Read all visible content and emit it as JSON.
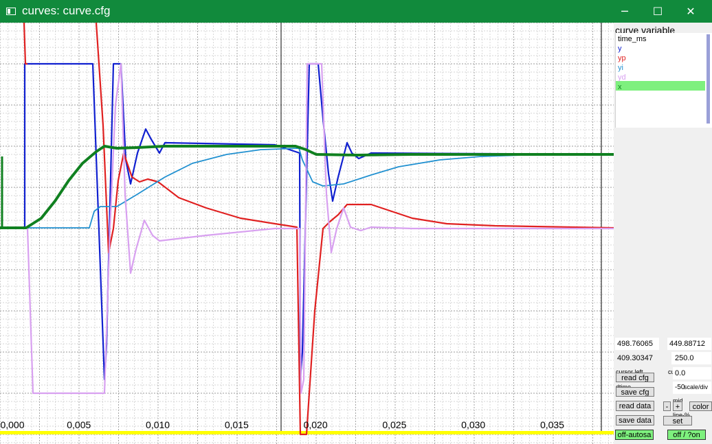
{
  "window": {
    "title": "curves: curve.cfg",
    "minimize_glyph": "─",
    "maximize_glyph": "☐",
    "close_glyph": "✕",
    "titlebar_color": "#118a3c"
  },
  "plot": {
    "x_tick_labels": [
      "0,000",
      "0,005",
      "0,010",
      "0,015",
      "0,020",
      "0,025",
      "0,030",
      "0,035"
    ],
    "x_range": [
      0.0,
      0.0389
    ],
    "series": [
      {
        "name": "time_ms",
        "color": "#000000"
      },
      {
        "name": "y",
        "color": "#1020d0"
      },
      {
        "name": "yp",
        "color": "#e02020"
      },
      {
        "name": "yi",
        "color": "#2090d0"
      },
      {
        "name": "yd",
        "color": "#d8a0f0"
      },
      {
        "name": "x",
        "color": "#108020"
      }
    ],
    "cursor_bar_color": "#ffff00"
  },
  "sidebar": {
    "list_title": "curve variable",
    "variables": [
      {
        "name": "time_ms",
        "color": "#000000"
      },
      {
        "name": "y",
        "color": "#1020d0"
      },
      {
        "name": "yp",
        "color": "#e02020"
      },
      {
        "name": "yi",
        "color": "#2090d0"
      },
      {
        "name": "yd",
        "color": "#d8a0f0"
      },
      {
        "name": "x",
        "color": "#108020"
      }
    ],
    "selected_variable": "x",
    "values": {
      "v1": "498.76065",
      "v2": "449.88712",
      "v3": "409.30347",
      "v4": "250.0",
      "v5": "0.0",
      "v6": "-50"
    },
    "labels": {
      "cursor_left": "cursor left",
      "cu": "cu",
      "dtime": "dtime",
      "scale_div": "scale/div",
      "mid": "mid",
      "line_pct": "line-%"
    },
    "buttons": {
      "read_cfg": "read cfg",
      "save_cfg": "save cfg",
      "read_data": "read data",
      "save_data": "save data",
      "minus": "-",
      "plus": "+",
      "color": "color",
      "set": "set",
      "autosave": "off-autosa",
      "toggle": "off / ?on"
    }
  }
}
